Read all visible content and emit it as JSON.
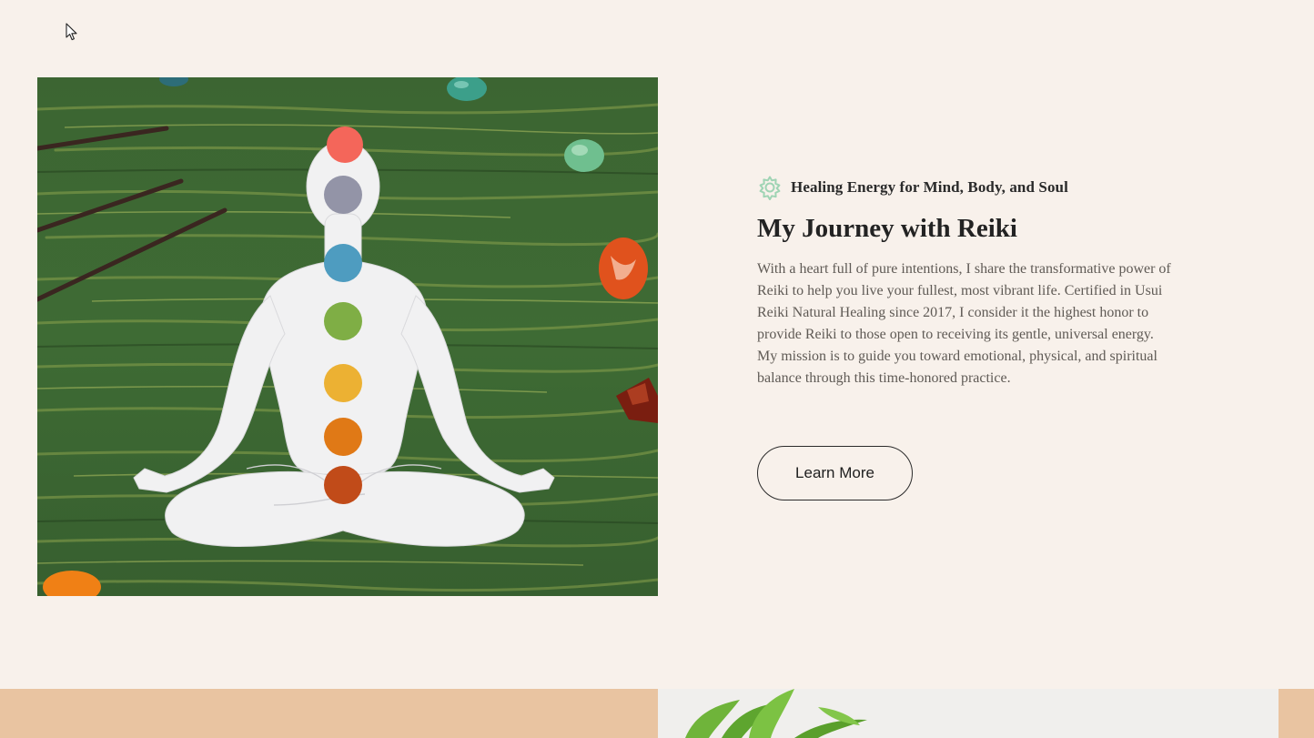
{
  "section": {
    "eyebrow": "Healing Energy for Mind, Body, and Soul",
    "eyebrow_icon": "gear-flower-icon",
    "title": "My Journey with Reiki",
    "body": "With a heart full of pure intentions, I share the transformative power of Reiki to help you live your fullest, most vibrant life. Certified in Usui Reiki Natural Healing since 2017, I consider it the highest honor to provide Reiki to those open to receiving its gentle, universal energy. My mission is to guide you toward emotional, physical, and spiritual balance through this time-honored practice.",
    "button_label": "Learn More"
  },
  "colors": {
    "page_background": "#f8f1eb",
    "accent_green": "#9fd4b4",
    "band_peach": "#e9c4a1",
    "wood_green": "#3f6a33",
    "chakras": [
      "#f4665a",
      "#9394a7",
      "#4e9cc0",
      "#7fae45",
      "#ecb133",
      "#e07916",
      "#c14b19"
    ]
  }
}
